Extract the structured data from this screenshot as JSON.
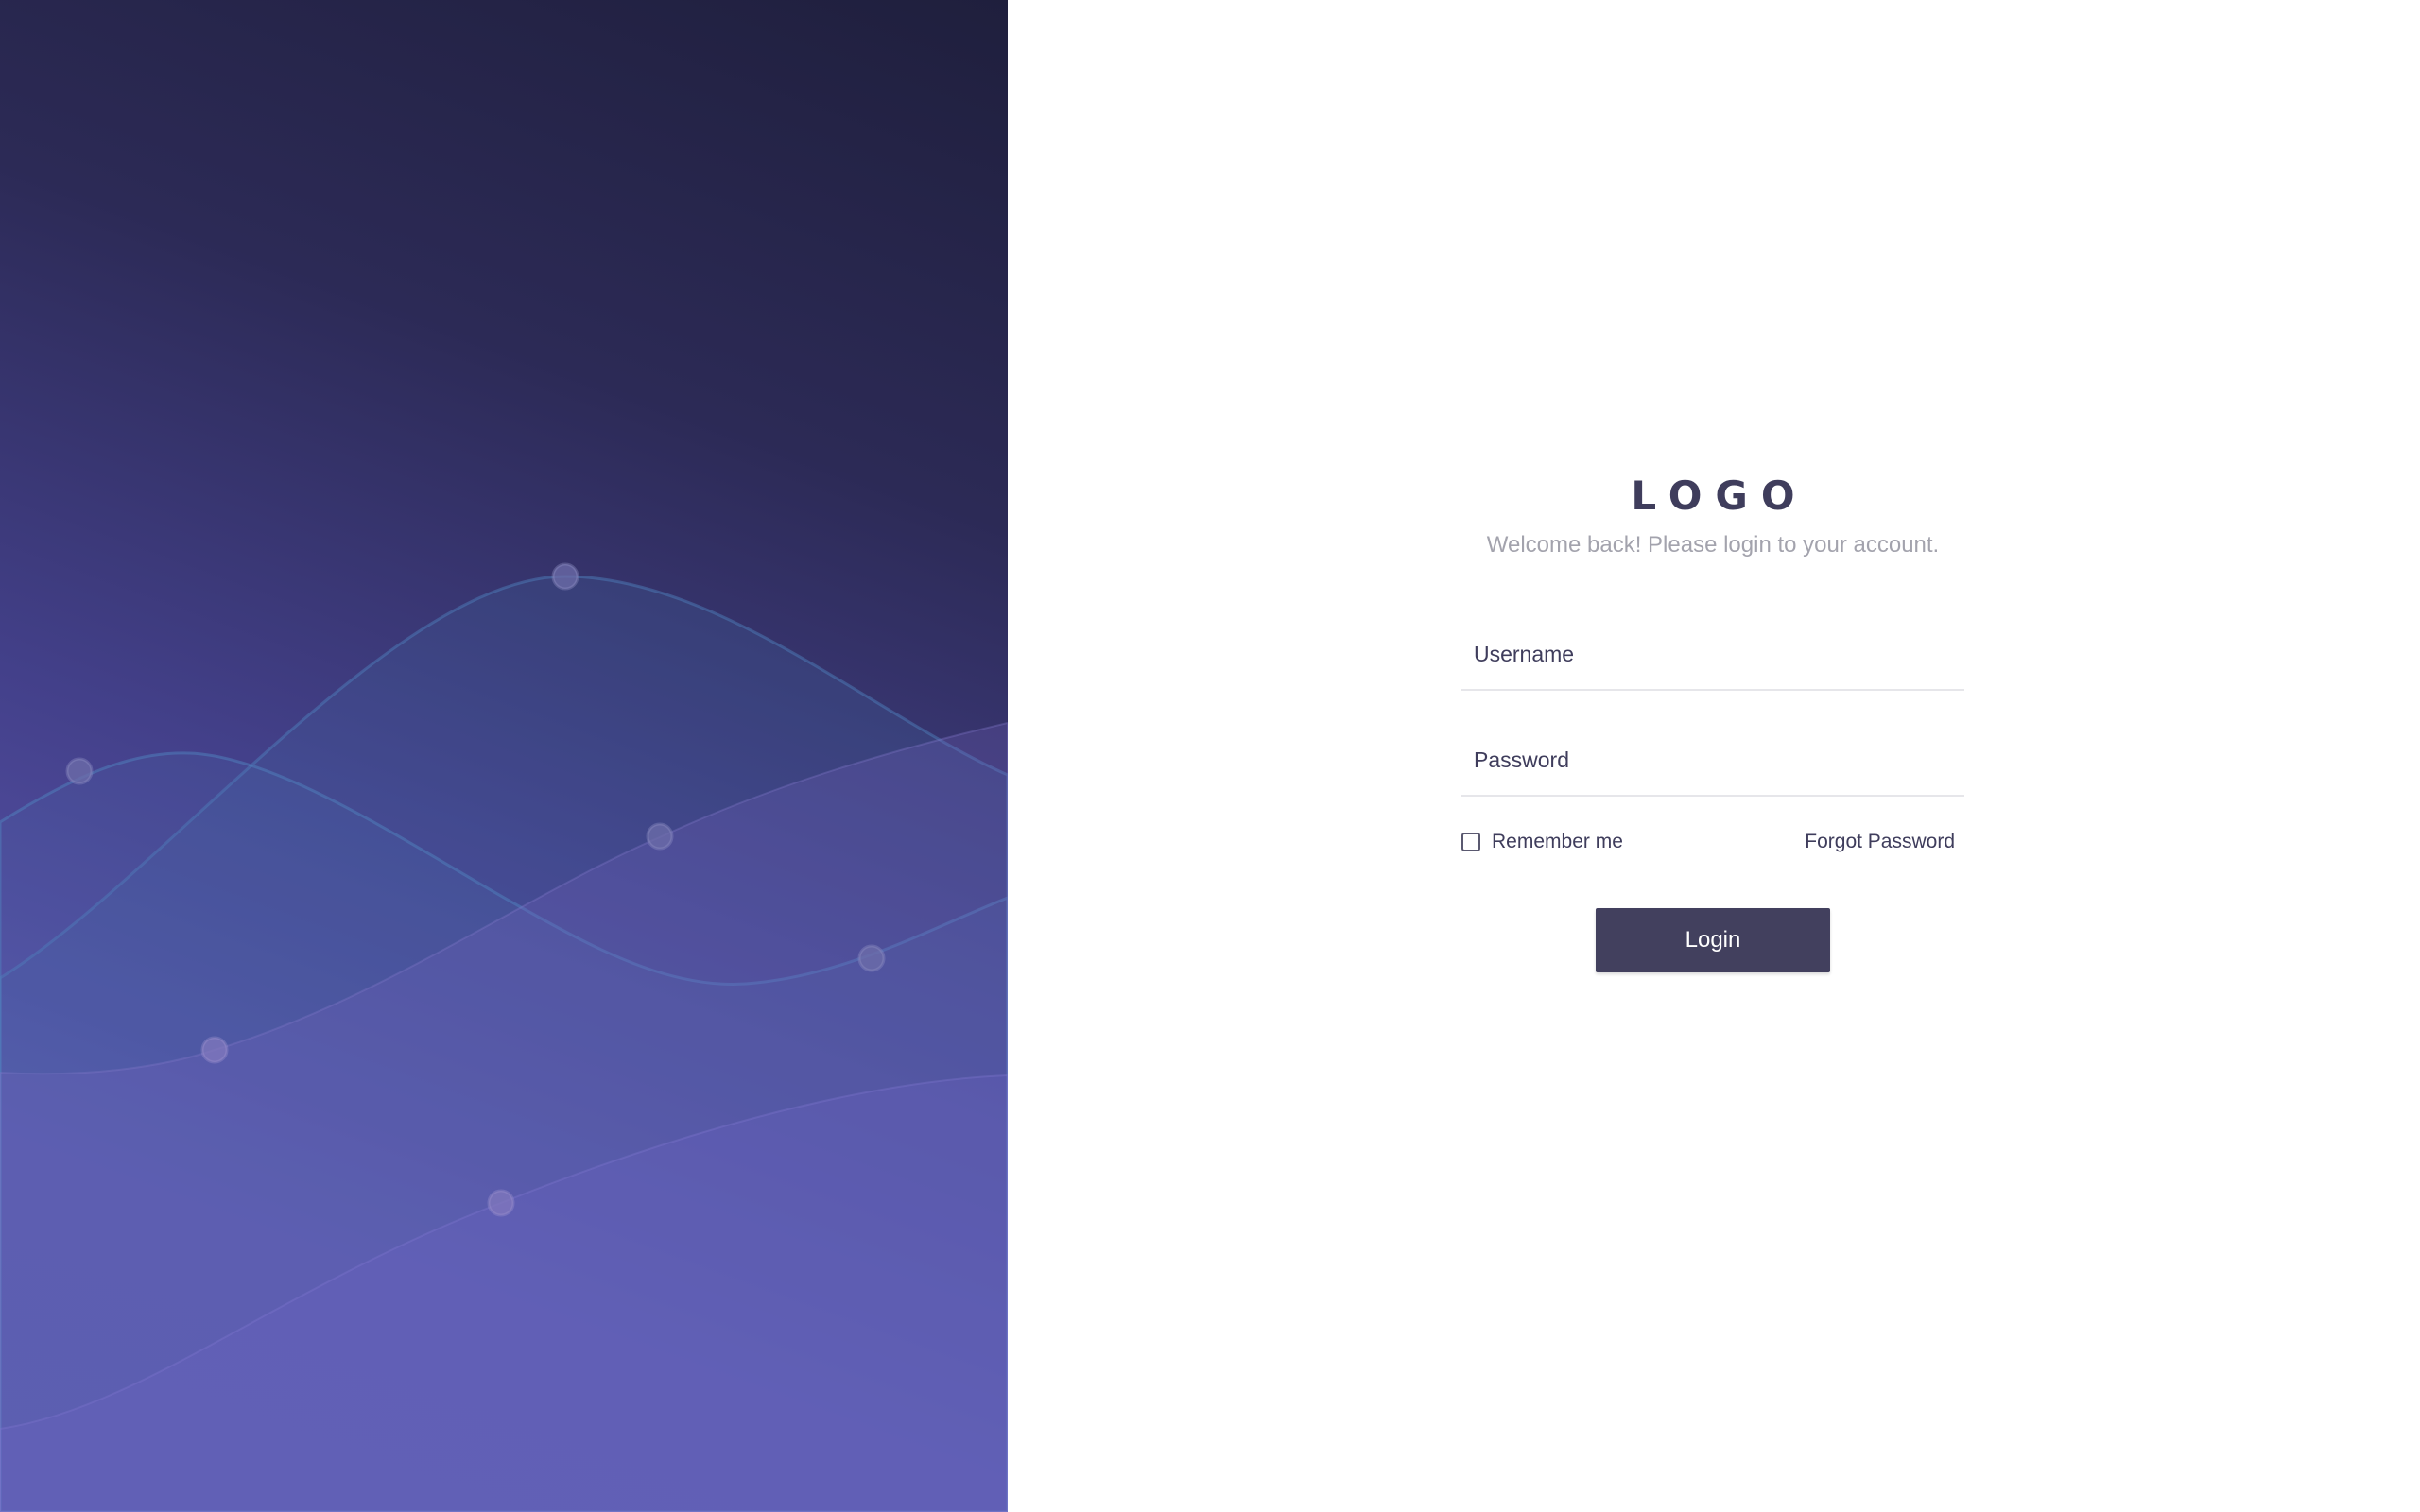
{
  "brand": {
    "logo_text": "LOGO",
    "subtitle": "Welcome back! Please login to your account."
  },
  "form": {
    "username_placeholder": "Username",
    "password_placeholder": "Password",
    "remember_label": "Remember me",
    "remember_checked": false,
    "forgot_label": "Forgot Password",
    "login_label": "Login"
  },
  "colors": {
    "panel_gradient_dark": "#1f1f3d",
    "panel_gradient_light": "#5b55ad",
    "text_primary": "#3f3d5c",
    "text_muted": "#a3a3ad",
    "button_background": "#42405e",
    "input_underline": "#e6e6ea"
  }
}
